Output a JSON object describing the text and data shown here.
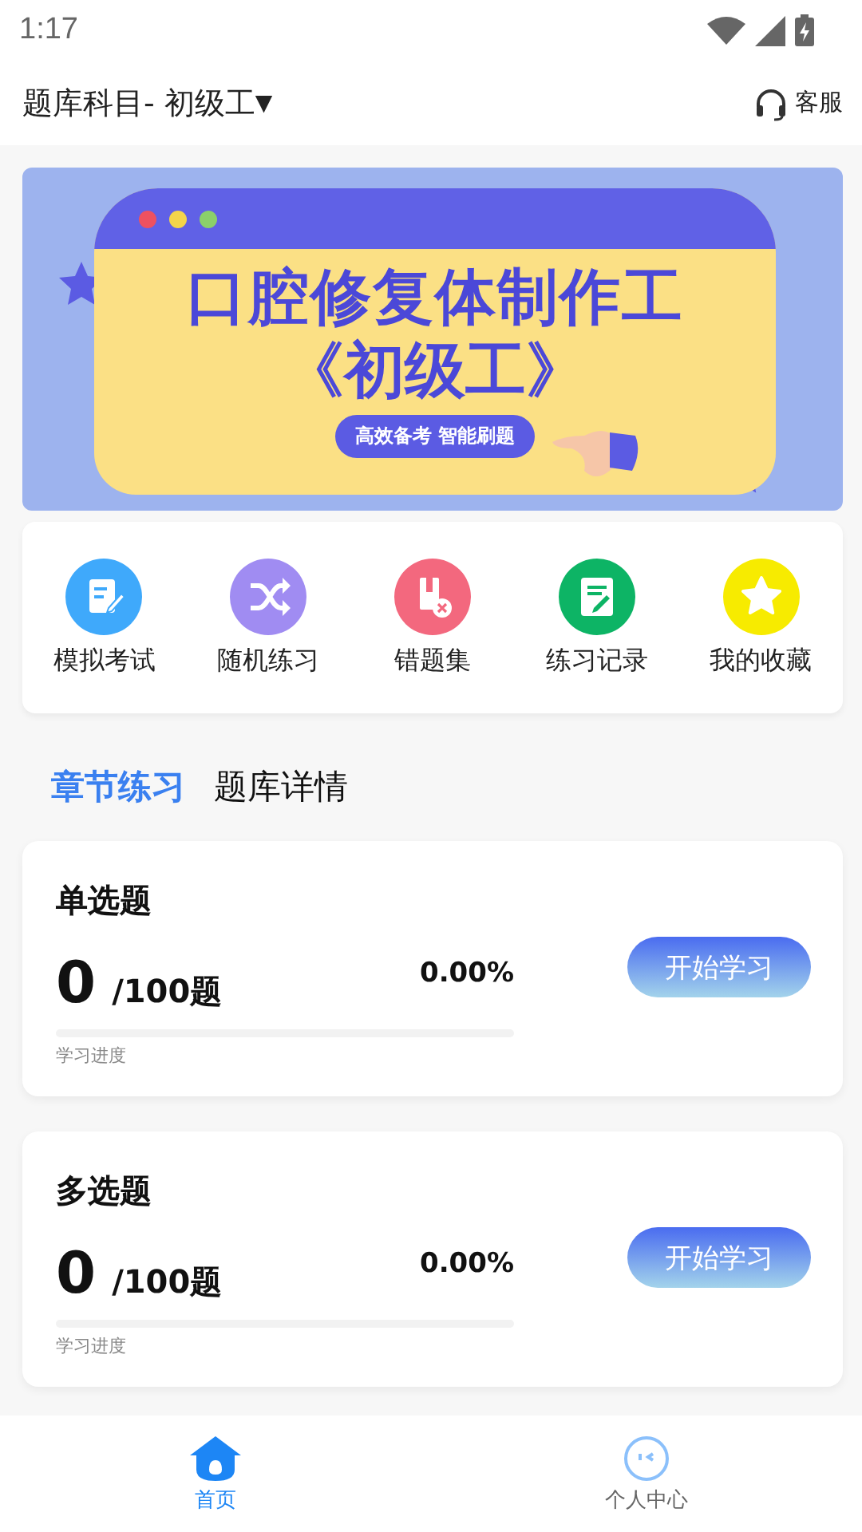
{
  "status_bar": {
    "time": "1:17"
  },
  "header": {
    "title": "题库科目- 初级工",
    "dropdown": "▼",
    "service": "客服"
  },
  "banner": {
    "title": "口腔修复体制作工",
    "subtitle": "《初级工》",
    "tagline": "高效备考 智能刷题"
  },
  "shortcuts": [
    {
      "label": "模拟考试",
      "kind": "exam",
      "color": "#3fa9fb"
    },
    {
      "label": "随机练习",
      "kind": "shuffle",
      "color": "#a08cf2"
    },
    {
      "label": "错题集",
      "kind": "wrong",
      "color": "#f3687e"
    },
    {
      "label": "练习记录",
      "kind": "record",
      "color": "#0db465"
    },
    {
      "label": "我的收藏",
      "kind": "favorite",
      "color": "#f7eb00"
    }
  ],
  "tabs": [
    {
      "label": "章节练习",
      "selected": true
    },
    {
      "label": "题库详情",
      "selected": false
    }
  ],
  "sections": [
    {
      "title": "单选题",
      "done": "0",
      "total": "/100题",
      "percent": "0.00%",
      "level": 0,
      "progress_label": "学习进度",
      "button": "开始学习"
    },
    {
      "title": "多选题",
      "done": "0",
      "total": "/100题",
      "percent": "0.00%",
      "level": 0,
      "progress_label": "学习进度",
      "button": "开始学习"
    }
  ],
  "bottom_nav": [
    {
      "label": "首页",
      "kind": "home",
      "selected": true
    },
    {
      "label": "个人中心",
      "kind": "profile",
      "selected": false
    }
  ]
}
